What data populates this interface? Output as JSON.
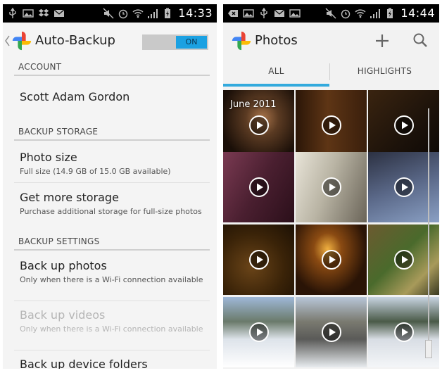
{
  "status_left": {
    "time": "14:33"
  },
  "status_right": {
    "time": "14:44"
  },
  "settings_screen": {
    "title": "Auto-Backup",
    "toggle_label": "ON",
    "sections": [
      {
        "header": "ACCOUNT",
        "items": [
          {
            "title": "Scott Adam Gordon"
          }
        ]
      },
      {
        "header": "BACKUP STORAGE",
        "items": [
          {
            "title": "Photo size",
            "subtitle": "Full size (14.9 GB of 15.0 GB available)"
          },
          {
            "title": "Get more storage",
            "subtitle": "Purchase additional storage for full-size photos"
          }
        ]
      },
      {
        "header": "BACKUP SETTINGS",
        "items": [
          {
            "title": "Back up photos",
            "subtitle": "Only when there is a Wi-Fi connection available"
          },
          {
            "title": "Back up videos",
            "subtitle": "Only when there is a Wi-Fi connection available",
            "disabled": true
          },
          {
            "title": "Back up device folders"
          }
        ]
      }
    ]
  },
  "photos_screen": {
    "title": "Photos",
    "tabs": [
      {
        "label": "ALL",
        "selected": true
      },
      {
        "label": "HIGHLIGHTS",
        "selected": false
      }
    ],
    "month_label": "June 2011",
    "thumbnail_count": 12
  },
  "colors": {
    "accent": "#33aadd",
    "toggle_on": "#1ba1e2",
    "status_bar": "#000000",
    "background": "#f4f4f4"
  },
  "icons": {
    "status_left": [
      "usb-icon",
      "image-icon",
      "dropbox-icon",
      "email-icon",
      "mute-icon",
      "alarm-icon",
      "wifi-icon",
      "signal-icon",
      "battery-charging-icon"
    ],
    "status_right": [
      "back-icon",
      "image-icon",
      "usb-icon",
      "email-icon",
      "image-icon",
      "mute-icon",
      "alarm-icon",
      "wifi-icon",
      "signal-icon",
      "battery-charging-icon"
    ],
    "photos_actions": [
      "plus-icon",
      "search-icon"
    ],
    "thumbnail_overlay": "play-icon"
  }
}
